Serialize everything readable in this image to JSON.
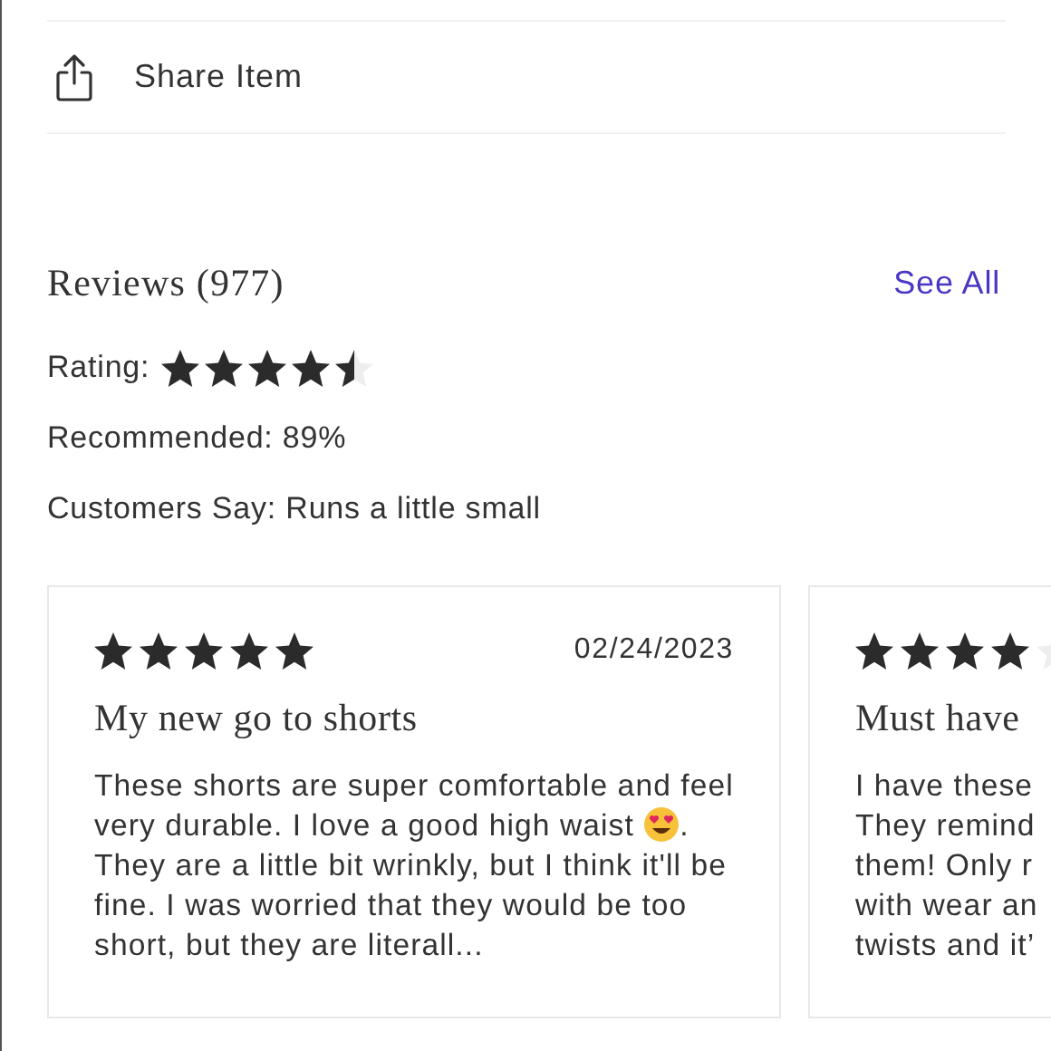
{
  "share": {
    "label": "Share Item"
  },
  "reviews": {
    "title": "Reviews (977)",
    "see_all": "See All",
    "rating_label": "Rating:",
    "stars": 4.5,
    "recommended": "Recommended: 89%",
    "customers_say": "Customers Say: Runs a little small"
  },
  "cards": [
    {
      "stars": 5,
      "date": "02/24/2023",
      "title": "My new go to shorts",
      "body": [
        "These shorts are super comfortable and feel very durable. I love a good high waist",
        ". They are a little bit wrinkly, but I think it'll be fine. I was worried that they would be too short, but they are literall..."
      ]
    },
    {
      "stars": 4,
      "title": "Must have",
      "body_lines": [
        "I have these",
        "They remind",
        "them! Only r",
        "with wear an",
        "twists and it’"
      ]
    }
  ]
}
